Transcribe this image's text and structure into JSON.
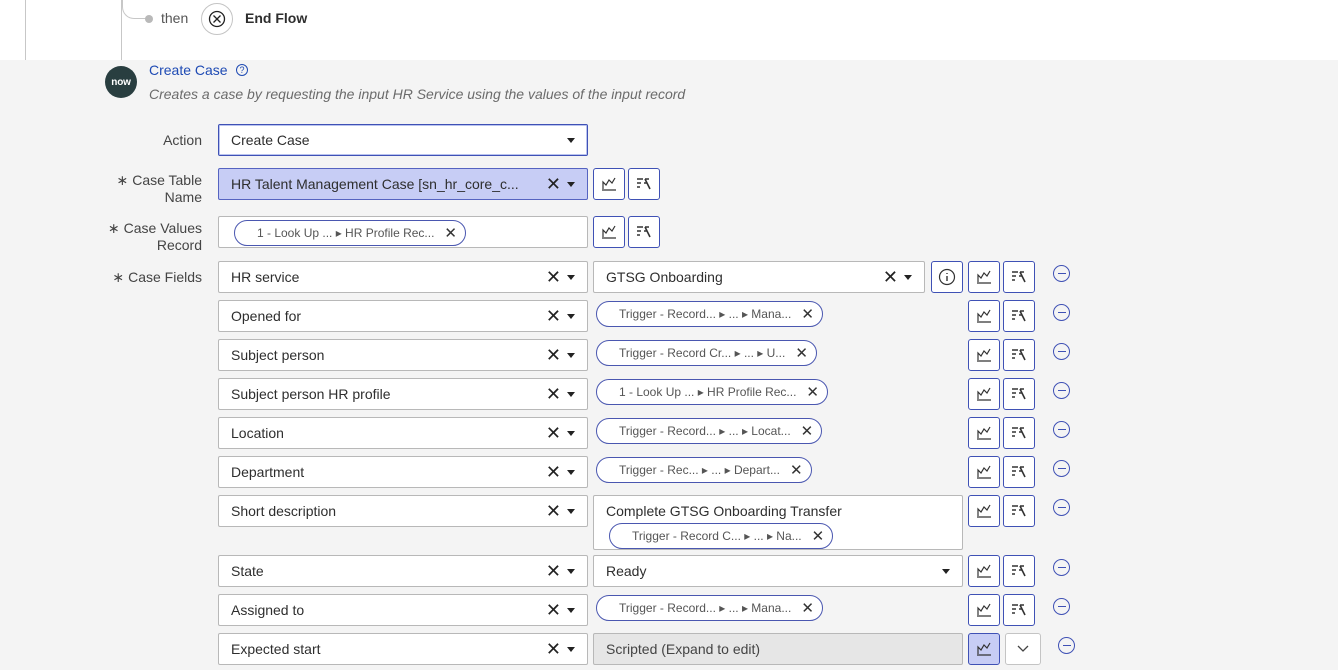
{
  "top": {
    "then_label": "then",
    "end_flow_label": "End Flow"
  },
  "action": {
    "logo_text": "now",
    "title": "Create Case",
    "help_glyph": "?",
    "subtitle": "Creates a case by requesting the input HR Service using the values of the input record"
  },
  "form": {
    "action_label": "Action",
    "action_value": "Create Case",
    "case_table_label_1": "Case Table",
    "case_table_label_2": "Name",
    "case_table_value": "HR Talent Management Case [sn_hr_core_c...",
    "case_values_label_1": "Case Values",
    "case_values_label_2": "Record",
    "case_values_pill": "1 - Look Up ... ▸ HR Profile Rec...",
    "case_fields_label": "Case Fields",
    "required_mark": "∗"
  },
  "rows": [
    {
      "field": "HR service",
      "value": "GTSG Onboarding"
    },
    {
      "field": "Opened for",
      "pill": "Trigger - Record... ▸ ... ▸ Mana..."
    },
    {
      "field": "Subject person",
      "pill": "Trigger - Record Cr... ▸ ... ▸ U..."
    },
    {
      "field": "Subject person HR profile",
      "pill": "1 - Look Up ... ▸ HR Profile Rec..."
    },
    {
      "field": "Location",
      "pill": "Trigger - Record... ▸ ... ▸ Locat..."
    },
    {
      "field": "Department",
      "pill": "Trigger - Rec... ▸ ... ▸ Depart..."
    },
    {
      "field": "Short description",
      "text": "Complete GTSG Onboarding Transfer",
      "pill": "Trigger - Record C... ▸ ... ▸ Na..."
    },
    {
      "field": "State",
      "value": "Ready"
    },
    {
      "field": "Assigned to",
      "pill": "Trigger - Record... ▸ ... ▸ Mana..."
    },
    {
      "field": "Expected start",
      "value": "Scripted (Expand to edit)"
    }
  ],
  "glyphs": {
    "clear": "✕",
    "pill_clear": "✕",
    "info": "i"
  }
}
